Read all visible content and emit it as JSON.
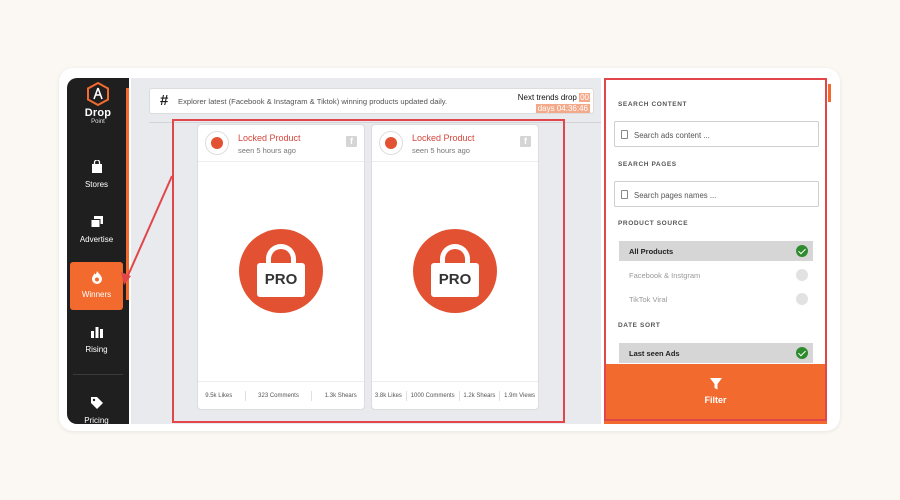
{
  "sidebar": {
    "brand": "Drop",
    "brand_sub": "Point",
    "items": [
      {
        "label": "Stores",
        "icon": "shopping-bag-icon"
      },
      {
        "label": "Advertise",
        "icon": "layers-icon"
      },
      {
        "label": "Winners",
        "icon": "fire-icon",
        "active": true
      },
      {
        "label": "Rising",
        "icon": "bar-chart-icon"
      },
      {
        "label": "Pricing",
        "icon": "tag-icon"
      }
    ]
  },
  "banner": {
    "message": "Explorer latest (Facebook & Instagram & Tiktok) winning products updated daily.",
    "trend_label": "Next trends drop",
    "trend_value": "00",
    "countdown": "days 04:36:46"
  },
  "cards": [
    {
      "title": "Locked Product",
      "seen": "seen 5 hours ago",
      "badge": "PRO",
      "stats": [
        "9.5k Likes",
        "323 Comments",
        "1.3k Shears"
      ]
    },
    {
      "title": "Locked Product",
      "seen": "seen 5 hours ago",
      "badge": "PRO",
      "stats": [
        "3.8k Likes",
        "1000 Comments",
        "1.2k Shears",
        "1.9m Views"
      ]
    }
  ],
  "panel": {
    "search_content_title": "SEARCH CONTENT",
    "search_content_placeholder": "Search ads content ...",
    "search_pages_title": "SEARCH PAGES",
    "search_pages_placeholder": "Search pages names ...",
    "product_source_title": "PRODUCT SOURCE",
    "sources": [
      {
        "label": "All Products",
        "selected": true
      },
      {
        "label": "Facebook & Instgram",
        "selected": false
      },
      {
        "label": "TikTok Viral",
        "selected": false
      }
    ],
    "date_sort_title": "DATE SORT",
    "date_sort": {
      "label": "Last seen Ads",
      "selected": true
    },
    "filter_label": "Filter"
  },
  "colors": {
    "accent": "#f26a2e",
    "highlight_outline": "#e0464a",
    "sidebar_bg": "#1f1f1f",
    "check": "#2e8b2e"
  }
}
